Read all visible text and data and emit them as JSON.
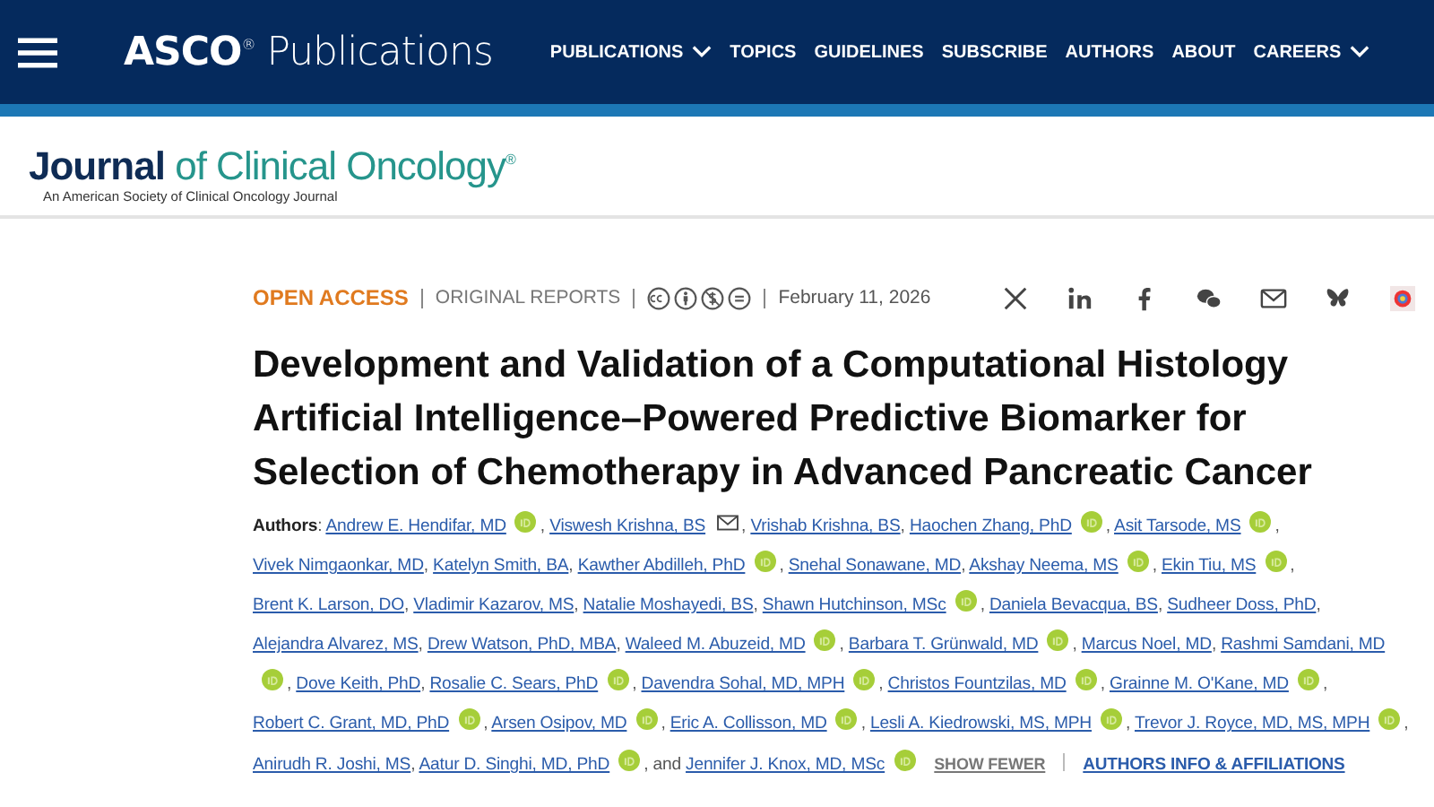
{
  "header": {
    "brand": "ASCO",
    "brand_mark": "®",
    "product": "Publications",
    "nav": [
      {
        "label": "PUBLICATIONS",
        "has_menu": true
      },
      {
        "label": "TOPICS",
        "has_menu": false
      },
      {
        "label": "GUIDELINES",
        "has_menu": false
      },
      {
        "label": "SUBSCRIBE",
        "has_menu": false
      },
      {
        "label": "AUTHORS",
        "has_menu": false
      },
      {
        "label": "ABOUT",
        "has_menu": false
      },
      {
        "label": "CAREERS",
        "has_menu": true
      }
    ]
  },
  "journal": {
    "title_lead": "Journal",
    "title_rest": "of Clinical Oncology",
    "title_mark": "®",
    "tagline": "An American Society of Clinical Oncology Journal"
  },
  "article": {
    "access": "OPEN ACCESS",
    "section": "ORIGINAL REPORTS",
    "date": "February 11, 2026",
    "licenses": [
      {
        "kind": "cc"
      },
      {
        "kind": "by"
      },
      {
        "kind": "nc"
      },
      {
        "kind": "nd"
      }
    ],
    "share": [
      {
        "kind": "x"
      },
      {
        "kind": "linkedin"
      },
      {
        "kind": "facebook"
      },
      {
        "kind": "wechat"
      },
      {
        "kind": "mail"
      },
      {
        "kind": "bluesky"
      },
      {
        "kind": "badge"
      }
    ],
    "title": "Development and Validation of a Computational Histology Artificial Intelligence–Powered Predictive Biomarker for Selection of Chemotherapy in Advanced Pancreatic Cancer",
    "authors_label": "**Authors**:",
    "authors": [
      {
        "name": "Andrew E. Hendifar, MD",
        "orcid": true,
        "email": false,
        "after": ","
      },
      {
        "name": "Viswesh Krishna, BS",
        "orcid": false,
        "email": true,
        "after": ","
      },
      {
        "name": "Vrishab Krishna, BS",
        "orcid": false,
        "email": false,
        "after": ","
      },
      {
        "name": "Haochen Zhang, PhD",
        "orcid": true,
        "email": false,
        "after": ","
      },
      {
        "name": "Asit Tarsode, MS",
        "orcid": true,
        "email": false,
        "after": ","
      },
      {
        "name": "Vivek Nimgaonkar, MD",
        "orcid": false,
        "email": false,
        "after": ","
      },
      {
        "name": "Katelyn Smith, BA",
        "orcid": false,
        "email": false,
        "after": ","
      },
      {
        "name": "Kawther Abdilleh, PhD",
        "orcid": true,
        "email": false,
        "after": ","
      },
      {
        "name": "Snehal Sonawane, MD",
        "orcid": false,
        "email": false,
        "after": ","
      },
      {
        "name": "Akshay Neema, MS",
        "orcid": true,
        "email": false,
        "after": ","
      },
      {
        "name": "Ekin Tiu, MS",
        "orcid": true,
        "email": false,
        "after": ","
      },
      {
        "name": "Brent K. Larson, DO",
        "orcid": false,
        "email": false,
        "after": ","
      },
      {
        "name": "Vladimir Kazarov, MS",
        "orcid": false,
        "email": false,
        "after": ","
      },
      {
        "name": "Natalie Moshayedi, BS",
        "orcid": false,
        "email": false,
        "after": ","
      },
      {
        "name": "Shawn Hutchinson, MSc",
        "orcid": true,
        "email": false,
        "after": ","
      },
      {
        "name": "Daniela Bevacqua, BS",
        "orcid": false,
        "email": false,
        "after": ","
      },
      {
        "name": "Sudheer Doss, PhD",
        "orcid": false,
        "email": false,
        "after": ","
      },
      {
        "name": "Alejandra Alvarez, MS",
        "orcid": false,
        "email": false,
        "after": ","
      },
      {
        "name": "Drew Watson, PhD, MBA",
        "orcid": false,
        "email": false,
        "after": ","
      },
      {
        "name": "Waleed M. Abuzeid, MD",
        "orcid": true,
        "email": false,
        "after": ","
      },
      {
        "name": "Barbara T. Grünwald, MD",
        "orcid": true,
        "email": false,
        "after": ","
      },
      {
        "name": "Marcus Noel, MD",
        "orcid": false,
        "email": false,
        "after": ","
      },
      {
        "name": "Rashmi Samdani, MD",
        "orcid": true,
        "email": false,
        "after": ","
      },
      {
        "name": "Dove Keith, PhD",
        "orcid": false,
        "email": false,
        "after": ","
      },
      {
        "name": "Rosalie C. Sears, PhD",
        "orcid": true,
        "email": false,
        "after": ","
      },
      {
        "name": "Davendra Sohal, MD, MPH",
        "orcid": true,
        "email": false,
        "after": ","
      },
      {
        "name": "Christos Fountzilas, MD",
        "orcid": true,
        "email": false,
        "after": ","
      },
      {
        "name": "Grainne M. O'Kane, MD",
        "orcid": true,
        "email": false,
        "after": ","
      },
      {
        "name": "Robert C. Grant, MD, PhD",
        "orcid": true,
        "email": false,
        "after": ","
      },
      {
        "name": "Arsen Osipov, MD",
        "orcid": true,
        "email": false,
        "after": ","
      },
      {
        "name": "Eric A. Collisson, MD",
        "orcid": true,
        "email": false,
        "after": ","
      },
      {
        "name": "Lesli A. Kiedrowski, MS, MPH",
        "orcid": true,
        "email": false,
        "after": ","
      },
      {
        "name": "Trevor J. Royce, MD, MS, MPH",
        "orcid": true,
        "email": false,
        "after": ","
      },
      {
        "name": "Anirudh R. Joshi, MS",
        "orcid": false,
        "email": false,
        "after": ","
      },
      {
        "name": "Aatur D. Singhi, MD, PhD",
        "orcid": true,
        "email": false,
        "after": ", and"
      },
      {
        "name": "Jennifer J. Knox, MD, MSc",
        "orcid": true,
        "email": false
      }
    ],
    "show_fewer": "SHOW FEWER",
    "affiliations": "AUTHORS INFO & AFFILIATIONS"
  }
}
